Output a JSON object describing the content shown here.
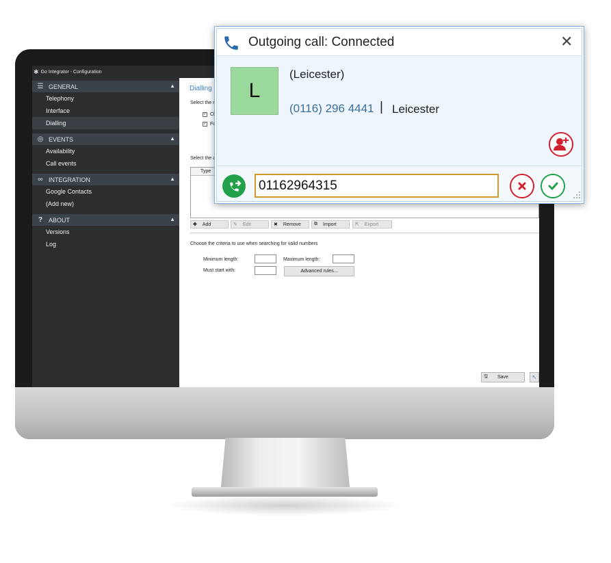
{
  "window": {
    "title": "Go Integrator - Configuration"
  },
  "sidebar": {
    "sections": [
      {
        "label": "GENERAL",
        "icon": "menu-icon",
        "items": [
          "Telephony",
          "Interface",
          "Dialling"
        ]
      },
      {
        "label": "EVENTS",
        "icon": "events-icon",
        "items": [
          "Availability",
          "Call events"
        ]
      },
      {
        "label": "INTEGRATION",
        "icon": "link-icon",
        "items": [
          "Google Contacts",
          "(Add new)"
        ]
      },
      {
        "label": "ABOUT",
        "icon": "question-icon",
        "items": [
          "Versions",
          "Log"
        ]
      }
    ],
    "active_item": "Dialling"
  },
  "content": {
    "page_title": "Dialling",
    "select_label_1": "Select the n",
    "checkbox_1_label": "Cl",
    "checkbox_2_label": "Fo",
    "select_label_2": "Select the a",
    "list_column_type": "Type",
    "toolbar": {
      "add": "Add",
      "edit": "Edit",
      "remove": "Remove",
      "import": "Import",
      "export": "Export"
    },
    "criteria_label": "Choose the criteria to use when searching for valid numbers",
    "min_length_label": "Minimum length:",
    "max_length_label": "Maximum length:",
    "must_start_label": "Must start with:",
    "advanced_rules": "Advanced rules...",
    "save": "Save"
  },
  "call_popup": {
    "title": "Outgoing call: Connected",
    "avatar_initial": "L",
    "contact_name": "(Leicester)",
    "contact_number": "(0116) 296 4441",
    "divider": "|",
    "contact_location": "Leicester",
    "dial_value": "01162964315",
    "colors": {
      "red": "#d3202f",
      "green": "#22a04a",
      "input_border": "#d29a2c",
      "avatar_bg": "#9bd89b"
    }
  }
}
